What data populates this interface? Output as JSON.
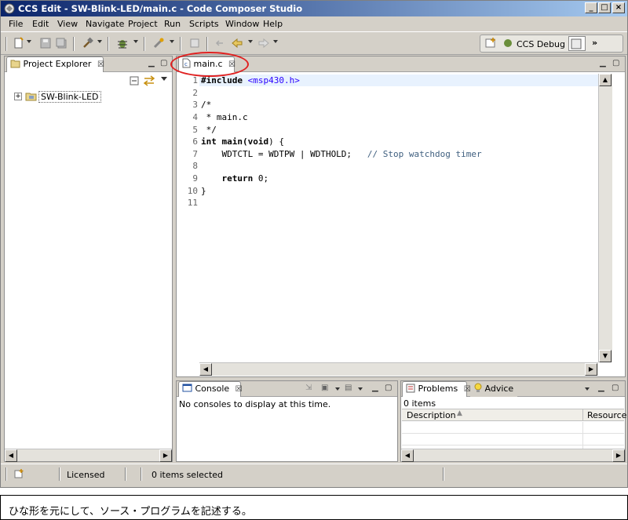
{
  "window": {
    "title": "CCS Edit - SW-Blink-LED/main.c - Code Composer Studio",
    "controls": {
      "minimize": "_",
      "maximize": "□",
      "close": "×"
    }
  },
  "menu": [
    "File",
    "Edit",
    "View",
    "Navigate",
    "Project",
    "Run",
    "Scripts",
    "Window",
    "Help"
  ],
  "perspective": {
    "label": "CCS Debug",
    "more": "»"
  },
  "project_explorer": {
    "tab_label": "Project Explorer",
    "tree": [
      {
        "label": "SW-Blink-LED",
        "expand_glyph": "+"
      }
    ]
  },
  "editor": {
    "tab_label": "main.c",
    "line_numbers": [
      "1",
      "2",
      "3",
      "4",
      "5",
      "6",
      "7",
      "8",
      "9",
      "10",
      "11"
    ],
    "lines": [
      {
        "kw": "#include",
        "rest": " <msp430.h>"
      },
      {
        "text": ""
      },
      {
        "text": "/*"
      },
      {
        "text": " * main.c"
      },
      {
        "text": " */"
      },
      {
        "kw": "int",
        "fn": " main(",
        "kw2": "void",
        "tail": ") {"
      },
      {
        "code": "    WDTCTL = WDTPW | WDTHOLD;",
        "comment": "   // Stop watchdog timer"
      },
      {
        "text": ""
      },
      {
        "kw": "    return",
        "rest": " 0;"
      },
      {
        "text": "}"
      },
      {
        "text": ""
      }
    ]
  },
  "console": {
    "tab_label": "Console",
    "message": "No consoles to display at this time."
  },
  "problems": {
    "tab_label": "Problems",
    "advice_tab_label": "Advice",
    "count": "0 items",
    "columns": [
      "Description",
      "Resource"
    ]
  },
  "status": {
    "licensed": "Licensed",
    "selection": "0 items selected"
  },
  "caption": "ひな形を元にして、ソース・プログラムを記述する。",
  "colors": {
    "titlebar": "#0a246a",
    "highlight_oval": "#e02020"
  }
}
